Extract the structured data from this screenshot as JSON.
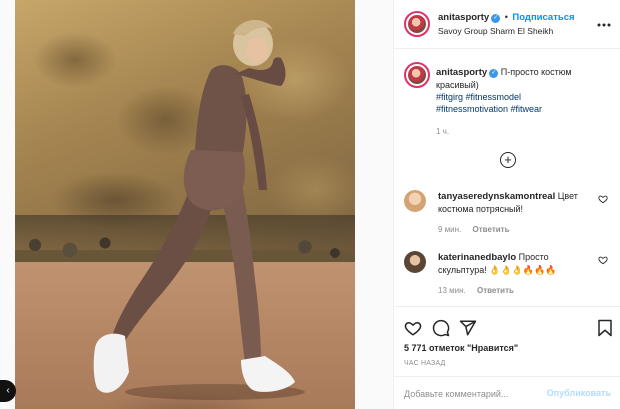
{
  "post": {
    "author": "anitasporty",
    "follow_label": "Подписаться",
    "dot": "•",
    "location": "Savoy Group Sharm El Sheikh",
    "more_icon": "more-horizontal-icon",
    "caption_text": "П-просто костюм красивый)",
    "hashtags": "#fitgirg #fitnessmodel #fitnessmotivation #fitwear",
    "time_ago": "1 ч.",
    "load_more_icon": "plus-circle-icon"
  },
  "comments": [
    {
      "user": "tanyaseredynskamontreal",
      "text": "Цвет костюма потрясный!",
      "time": "9 мин.",
      "reply": "Ответить"
    },
    {
      "user": "katerinanedbaylo",
      "text": "Просто скульптура! 👌👌👌🔥🔥🔥",
      "time": "13 мин.",
      "reply": "Ответить"
    }
  ],
  "actions": {
    "likes": "5 771 отметок \"Нравится\"",
    "posted": "ЧАС НАЗАД",
    "icons": [
      "heart-icon",
      "comment-icon",
      "share-icon",
      "bookmark-icon"
    ]
  },
  "comment_box": {
    "placeholder": "Добавьте комментарий...",
    "publish": "Опубликовать"
  },
  "nav": {
    "prev_label": "‹"
  },
  "colors": {
    "link": "#0095f6",
    "hashtag": "#00376b",
    "muted": "#8e8e8e"
  }
}
